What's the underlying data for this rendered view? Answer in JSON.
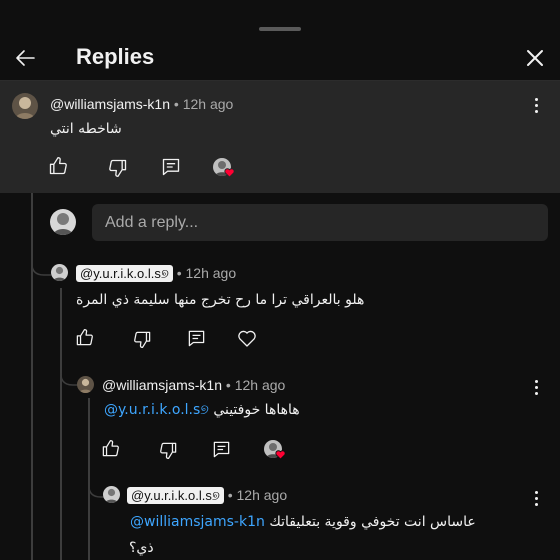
{
  "header": {
    "title": "Replies"
  },
  "parent_comment": {
    "username": "@williamsjams-k1n",
    "time": "• 12h ago",
    "text": "شاخطه انتي"
  },
  "reply_input": {
    "placeholder": "Add a reply..."
  },
  "replies": [
    {
      "username": "@y.u.r.i.k.o.l.s୭",
      "time": "• 12h ago",
      "text": "هلو بالعراقي ترا ما رح تخرج منها سليمة ذي المرة"
    },
    {
      "username": "@williamsjams-k1n",
      "time": "• 12h ago",
      "mention": "@y.u.r.i.k.o.l.s୭",
      "text": "هاهاها خوفتيني"
    },
    {
      "username": "@y.u.r.i.k.o.l.s୭",
      "time": "• 12h ago",
      "mention": "@williamsjams-k1n",
      "text": "عاساس انت تخوفي وقوية بتعليقاتك",
      "text_line2": "ذي؟"
    }
  ],
  "colors": {
    "background": "#0f0f0f",
    "parent_bg": "#272727",
    "mention": "#3ea6ff",
    "heart_badge": "#ff0033"
  }
}
